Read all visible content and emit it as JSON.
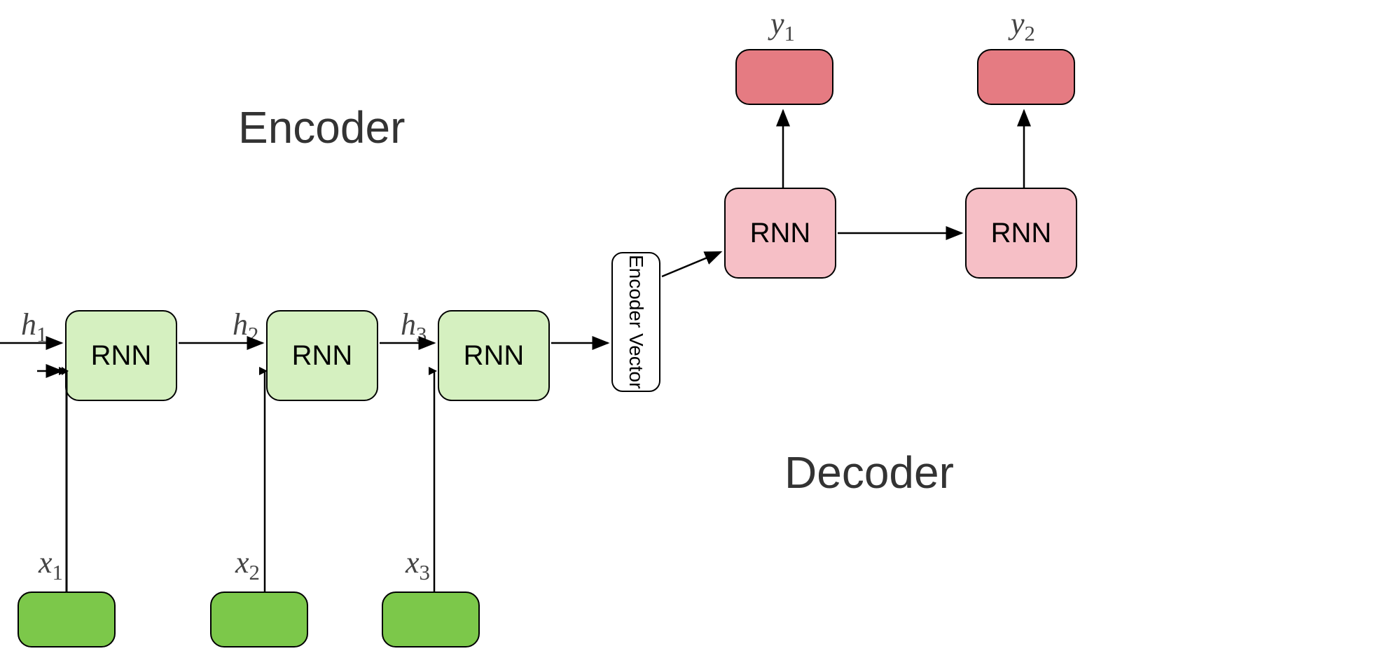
{
  "titles": {
    "encoder": "Encoder",
    "decoder": "Decoder"
  },
  "blocks": {
    "rnn": "RNN",
    "encoderVector": "Encoder Vector"
  },
  "inputs": {
    "x1": "x",
    "x1_sub": "1",
    "x2": "x",
    "x2_sub": "2",
    "x3": "x",
    "x3_sub": "3"
  },
  "hidden": {
    "h1": "h",
    "h1_sub": "1",
    "h2": "h",
    "h2_sub": "2",
    "h3": "h",
    "h3_sub": "3"
  },
  "outputs": {
    "y1": "y",
    "y1_sub": "1",
    "y2": "y",
    "y2_sub": "2"
  },
  "diagram": {
    "type": "encoder-decoder-rnn",
    "encoder_steps": 3,
    "decoder_steps": 2,
    "colors": {
      "encoder_rnn": "#d5f0c0",
      "input": "#7cc84a",
      "decoder_rnn": "#f6bfc6",
      "output": "#e57b82"
    }
  }
}
